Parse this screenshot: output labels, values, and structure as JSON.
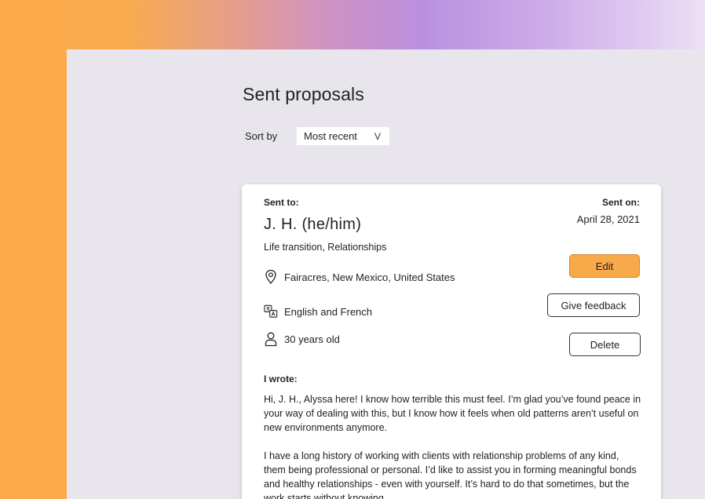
{
  "page": {
    "title": "Sent proposals"
  },
  "sort": {
    "label": "Sort by",
    "selected": "Most recent",
    "chevron": "V"
  },
  "proposal": {
    "sent_to_label": "Sent to:",
    "name": "J. H. (he/him)",
    "topics": "Life transition, Relationships",
    "sent_on_label": "Sent on:",
    "sent_on_date": "April 28, 2021",
    "location": "Fairacres, New Mexico, United States",
    "languages": "English and French",
    "age": "30 years old",
    "buttons": {
      "edit": "Edit",
      "feedback": "Give feedback",
      "delete": "Delete"
    },
    "wrote_label": "I wrote:",
    "message_paragraphs": [
      "Hi, J. H., Alyssa here! I know how terrible this must feel. I’m glad you’ve found peace in your way of dealing with this, but I know how it feels when old patterns aren’t useful on new environments anymore.",
      "I have a long history of working with clients with relationship problems of any kind, them being professional or personal. I’d like to assist you in forming meaningful bonds and healthy relationships - even with yourself. It’s hard to do that sometimes, but the work starts without knowing"
    ]
  },
  "colors": {
    "accent": "#f8a94a",
    "page_bg": "#e8e6ec",
    "gradient_left": "#fdab4a",
    "gradient_mid": "#b990df",
    "gradient_right": "#ece0f4"
  },
  "icons": {
    "location": "map-pin-icon",
    "language": "translate-icon",
    "age": "person-icon"
  }
}
